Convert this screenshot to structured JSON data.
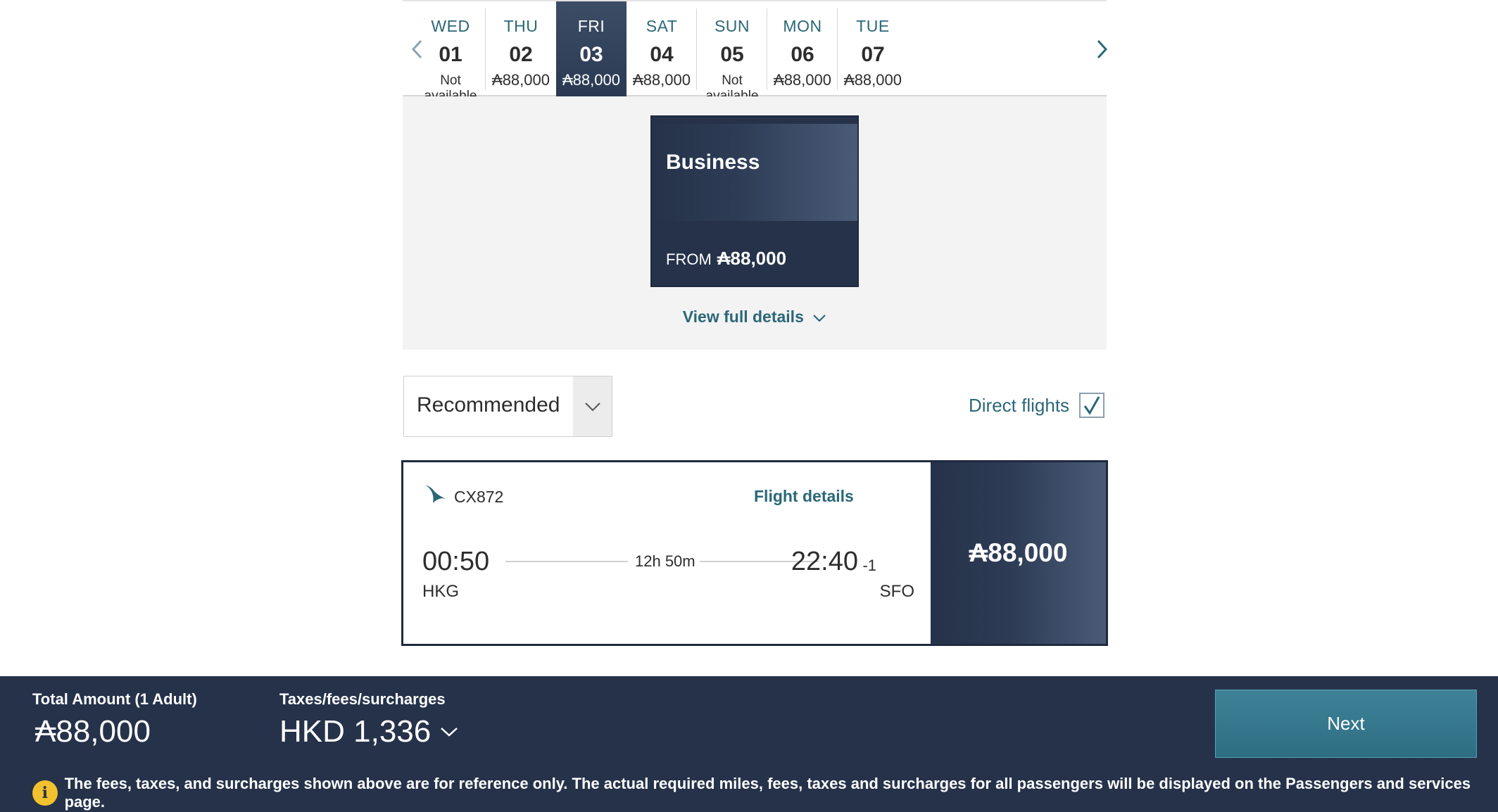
{
  "date_strip": {
    "prev_icon": "chevron-left-icon",
    "next_icon": "chevron-right-icon",
    "dates": [
      {
        "dow": "WED",
        "day": "01",
        "price": "Not available",
        "available": false,
        "selected": false
      },
      {
        "dow": "THU",
        "day": "02",
        "price": "₳88,000",
        "available": true,
        "selected": false
      },
      {
        "dow": "FRI",
        "day": "03",
        "price": "₳88,000",
        "available": true,
        "selected": true
      },
      {
        "dow": "SAT",
        "day": "04",
        "price": "₳88,000",
        "available": true,
        "selected": false
      },
      {
        "dow": "SUN",
        "day": "05",
        "price": "Not available",
        "available": false,
        "selected": false
      },
      {
        "dow": "MON",
        "day": "06",
        "price": "₳88,000",
        "available": true,
        "selected": false
      },
      {
        "dow": "TUE",
        "day": "07",
        "price": "₳88,000",
        "available": true,
        "selected": false
      }
    ]
  },
  "cabin": {
    "name": "Business",
    "from_label": "FROM",
    "from_amount": "₳88,000"
  },
  "view_full_details": "View full details",
  "sort": {
    "selected": "Recommended"
  },
  "direct_flights": {
    "label": "Direct flights",
    "checked": true
  },
  "flight": {
    "number": "CX872",
    "details_link": "Flight details",
    "departure_time": "00:50",
    "departure_code": "HKG",
    "duration": "12h 50m",
    "arrival_time": "22:40",
    "arrival_offset": "-1",
    "arrival_code": "SFO",
    "price": "₳88,000"
  },
  "footer": {
    "total_label": "Total Amount (1 Adult)",
    "total_value": "₳88,000",
    "tax_label": "Taxes/fees/surcharges",
    "tax_value": "HKD 1,336",
    "next_label": "Next",
    "notice": "The fees, taxes, and surcharges shown above are for reference only. The actual required miles, fees, taxes and surcharges for all passengers will be displayed on the Passengers and services page."
  },
  "colors": {
    "navy": "#25324a",
    "teal_text": "#2b6777",
    "next_button": "#3e8297",
    "info_yellow": "#f2c12e"
  }
}
